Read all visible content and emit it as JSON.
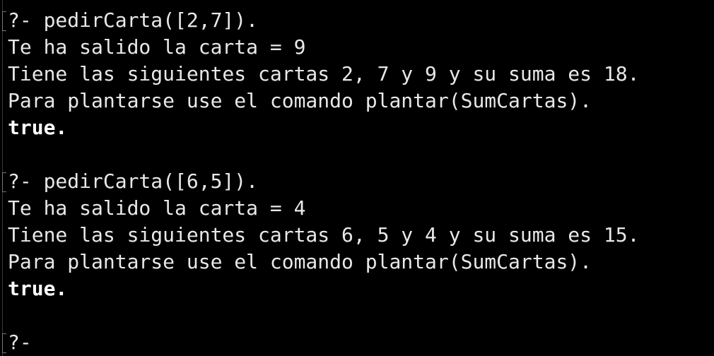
{
  "terminal": {
    "lines": [
      {
        "text": "?- pedirCarta([2,7]).",
        "bold": false
      },
      {
        "text": "Te ha salido la carta = 9",
        "bold": false
      },
      {
        "text": "Tiene las siguientes cartas 2, 7 y 9 y su suma es 18.",
        "bold": false
      },
      {
        "text": "Para plantarse use el comando plantar(SumCartas).",
        "bold": false
      },
      {
        "text": "true.",
        "bold": true
      },
      {
        "text": "",
        "bold": false
      },
      {
        "text": "?- pedirCarta([6,5]).",
        "bold": false
      },
      {
        "text": "Te ha salido la carta = 4",
        "bold": false
      },
      {
        "text": "Tiene las siguientes cartas 6, 5 y 4 y su suma es 15.",
        "bold": false
      },
      {
        "text": "Para plantarse use el comando plantar(SumCartas).",
        "bold": false
      },
      {
        "text": "true.",
        "bold": true
      },
      {
        "text": "",
        "bold": false
      },
      {
        "text": "?-",
        "bold": false
      }
    ]
  },
  "colors": {
    "background": "#000000",
    "text": "#e8e8e8"
  }
}
